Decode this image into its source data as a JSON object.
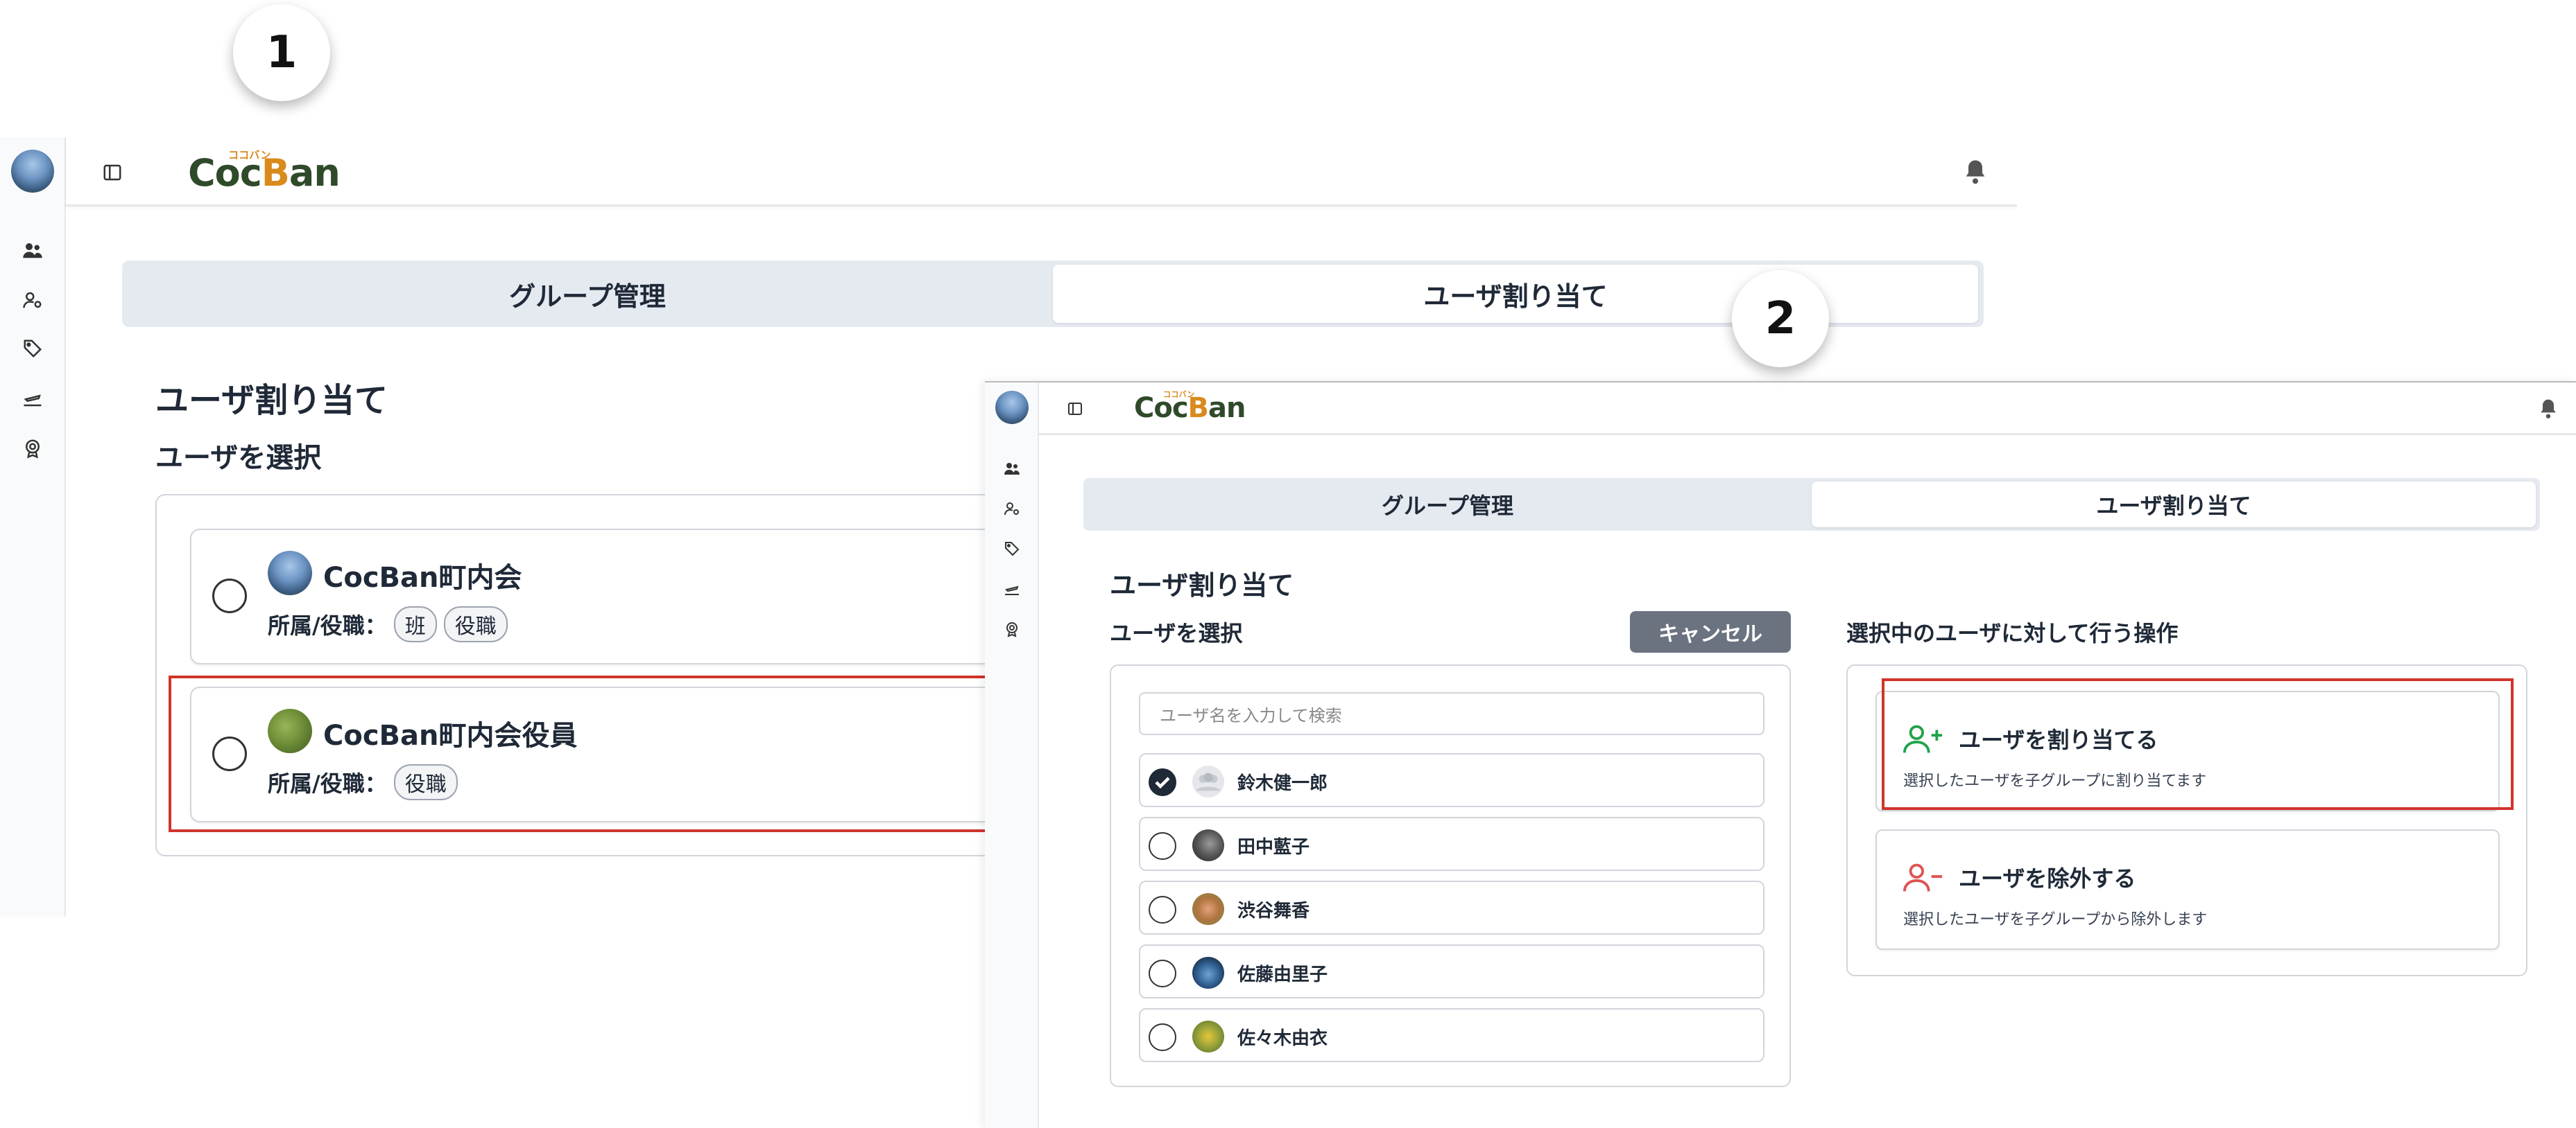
{
  "badges": {
    "step1": "1",
    "step2": "2"
  },
  "logo": {
    "text_left": "Coc",
    "text_b": "B",
    "text_right": "an",
    "ruby": "ココバン"
  },
  "screen1": {
    "tabs": [
      {
        "label": "グループ管理",
        "active": false
      },
      {
        "label": "ユーザ割り当て",
        "active": true
      }
    ],
    "heading": "ユーザ割り当て",
    "subheading": "ユーザを選択",
    "groups": [
      {
        "name": "CocBan町内会",
        "meta_label": "所属/役職：",
        "tags": [
          "班",
          "役職"
        ],
        "selected": false
      },
      {
        "name": "CocBan町内会役員",
        "meta_label": "所属/役職：",
        "tags": [
          "役職"
        ],
        "selected": false,
        "highlighted": true
      }
    ]
  },
  "screen2": {
    "tabs": [
      {
        "label": "グループ管理",
        "active": false
      },
      {
        "label": "ユーザ割り当て",
        "active": true
      }
    ],
    "heading": "ユーザ割り当て",
    "subheading": "ユーザを選択",
    "cancel_label": "キャンセル",
    "search_placeholder": "ユーザ名を入力して検索",
    "users": [
      {
        "name": "鈴木健一郎",
        "checked": true
      },
      {
        "name": "田中藍子",
        "checked": false
      },
      {
        "name": "渋谷舞香",
        "checked": false
      },
      {
        "name": "佐藤由里子",
        "checked": false
      },
      {
        "name": "佐々木由衣",
        "checked": false
      }
    ],
    "ops_title": "選択中のユーザに対して行う操作",
    "operations": [
      {
        "title": "ユーザを割り当てる",
        "desc": "選択したユーザを子グループに割り当てます",
        "icon": "user-plus-icon",
        "color": "#22a34a",
        "highlighted": true
      },
      {
        "title": "ユーザを除外する",
        "desc": "選択したユーザを子グループから除外します",
        "icon": "user-minus-icon",
        "color": "#e05252",
        "highlighted": false
      }
    ]
  },
  "colors": {
    "highlight": "#d0342c",
    "logo_green": "#2f4a2a",
    "logo_orange": "#d98a1c",
    "cancel_bg": "#6b7280"
  }
}
